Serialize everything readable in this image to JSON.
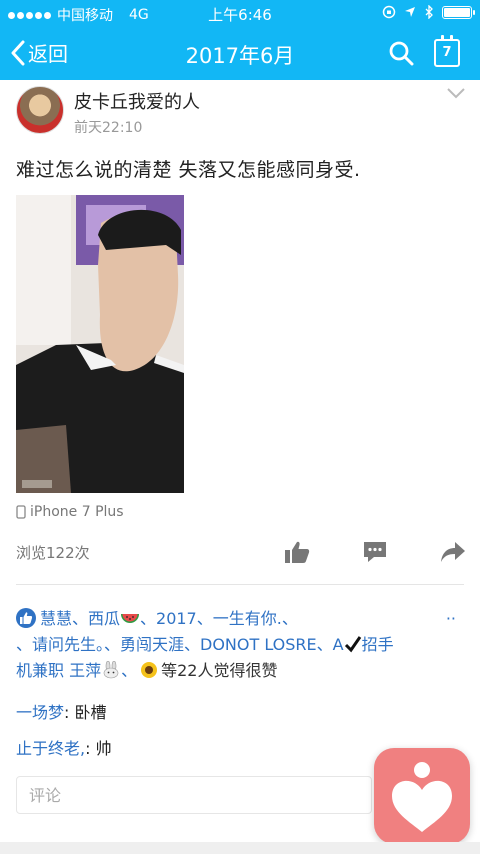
{
  "status": {
    "carrier": "中国移动",
    "network": "4G",
    "time": "上午6:46"
  },
  "nav": {
    "back_label": "返回",
    "title": "2017年6月",
    "calendar_day": "7"
  },
  "post": {
    "author": "皮卡丘我爱的人",
    "time": "前天22:10",
    "text": "难过怎么说的清楚 失落又怎能感同身受.",
    "device": "iPhone 7 Plus",
    "views": "浏览122次"
  },
  "likes": {
    "names_line1_a": "慧慧、西瓜",
    "names_line1_b": "、2017、一生有你.、",
    "dots": "··",
    "names_line2_a": "、请问先生。、勇闯天涯、DONOT   LOSRE、A",
    "names_line2_b": "招手",
    "names_line3_a": "机兼职 王萍",
    "names_line3_b": "、",
    "summary": "等22人觉得很赞"
  },
  "comments": [
    {
      "name": "一场梦",
      "sep": ": ",
      "text": "卧槽"
    },
    {
      "name": "止于终老,",
      "sep": ": ",
      "text": "帅"
    }
  ],
  "comment_input": {
    "placeholder": "评论"
  },
  "colors": {
    "brand": "#12b7f5",
    "link": "#2f72c4",
    "float_button": "#f08080"
  }
}
